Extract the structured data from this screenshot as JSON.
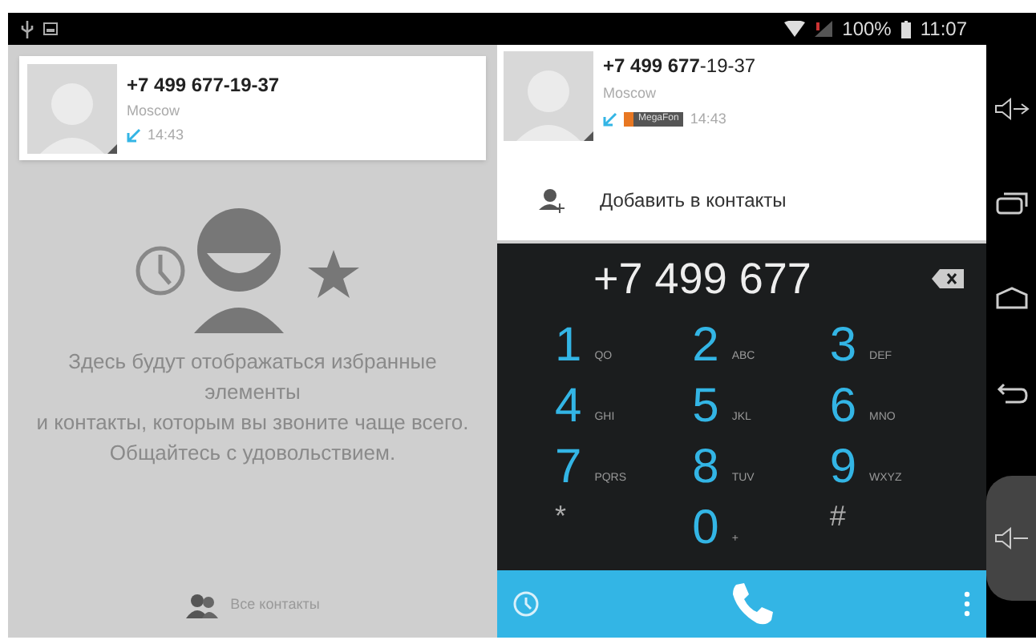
{
  "status_bar": {
    "battery": "100%",
    "time": "11:07"
  },
  "favorites": {
    "card": {
      "number": "+7 499 677-19-37",
      "location": "Moscow",
      "time": "14:43"
    },
    "empty_message": [
      "Здесь будут отображаться избранные элементы",
      "и контакты, которым вы звоните чаще всего.",
      "Общайтесь с удовольствием."
    ],
    "all_contacts": "Все контакты"
  },
  "dialer": {
    "match": {
      "number": "**+7 499 677**-19-37",
      "location": "Moscow",
      "operator": "MegaFon",
      "time": "14:43"
    },
    "add_contact": "Добавить в контакты",
    "input": "+7 499 677",
    "keys": [
      {
        "digit": "1",
        "letters": "QO"
      },
      {
        "digit": "2",
        "letters": "ABC"
      },
      {
        "digit": "3",
        "letters": "DEF"
      },
      {
        "digit": "4",
        "letters": "GHI"
      },
      {
        "digit": "5",
        "letters": "JKL"
      },
      {
        "digit": "6",
        "letters": "MNO"
      },
      {
        "digit": "7",
        "letters": "PQRS"
      },
      {
        "digit": "8",
        "letters": "TUV"
      },
      {
        "digit": "9",
        "letters": "WXYZ"
      },
      {
        "digit": "*"
      },
      {
        "digit": "0",
        "letters": "+"
      },
      {
        "digit": "#"
      }
    ]
  }
}
